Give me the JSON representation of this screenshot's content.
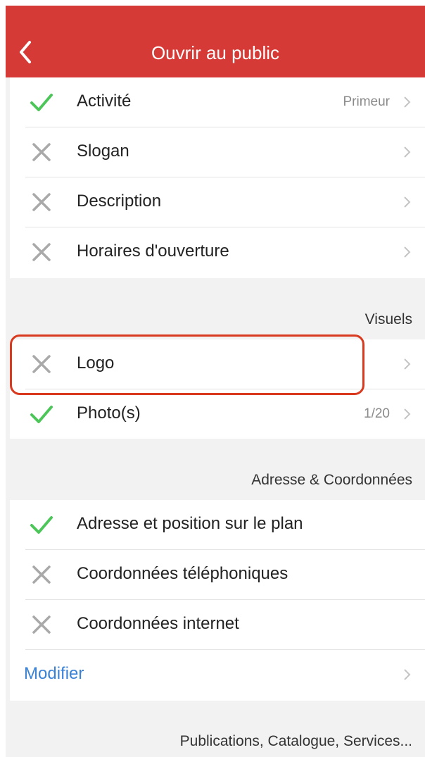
{
  "nav": {
    "title": "Ouvrir au public"
  },
  "icons": {
    "check": "check-icon",
    "cross": "cross-icon",
    "chevron": "chevron-right-icon",
    "back": "back-arrow-icon"
  },
  "colors": {
    "nav_bg": "#d63a36",
    "check": "#4cc559",
    "cross": "#a9a9a9",
    "link": "#3b82d6",
    "highlight": "#d93a1f"
  },
  "general": {
    "items": [
      {
        "label": "Activité",
        "value": "Primeur",
        "status": "done"
      },
      {
        "label": "Slogan",
        "value": "",
        "status": "todo"
      },
      {
        "label": "Description",
        "value": "",
        "status": "todo"
      },
      {
        "label": "Horaires d'ouverture",
        "value": "",
        "status": "todo"
      }
    ]
  },
  "visuels": {
    "header": "Visuels",
    "items": [
      {
        "label": "Logo",
        "value": "",
        "status": "todo",
        "highlighted": true
      },
      {
        "label": "Photo(s)",
        "value": "1/20",
        "status": "done"
      }
    ]
  },
  "adresse": {
    "header": "Adresse & Coordonnées",
    "items": [
      {
        "label": "Adresse et position sur le plan",
        "status": "done"
      },
      {
        "label": "Coordonnées téléphoniques",
        "status": "todo"
      },
      {
        "label": "Coordonnées internet",
        "status": "todo"
      }
    ],
    "modify_label": "Modifier"
  },
  "publications": {
    "header": "Publications, Catalogue, Services..."
  }
}
